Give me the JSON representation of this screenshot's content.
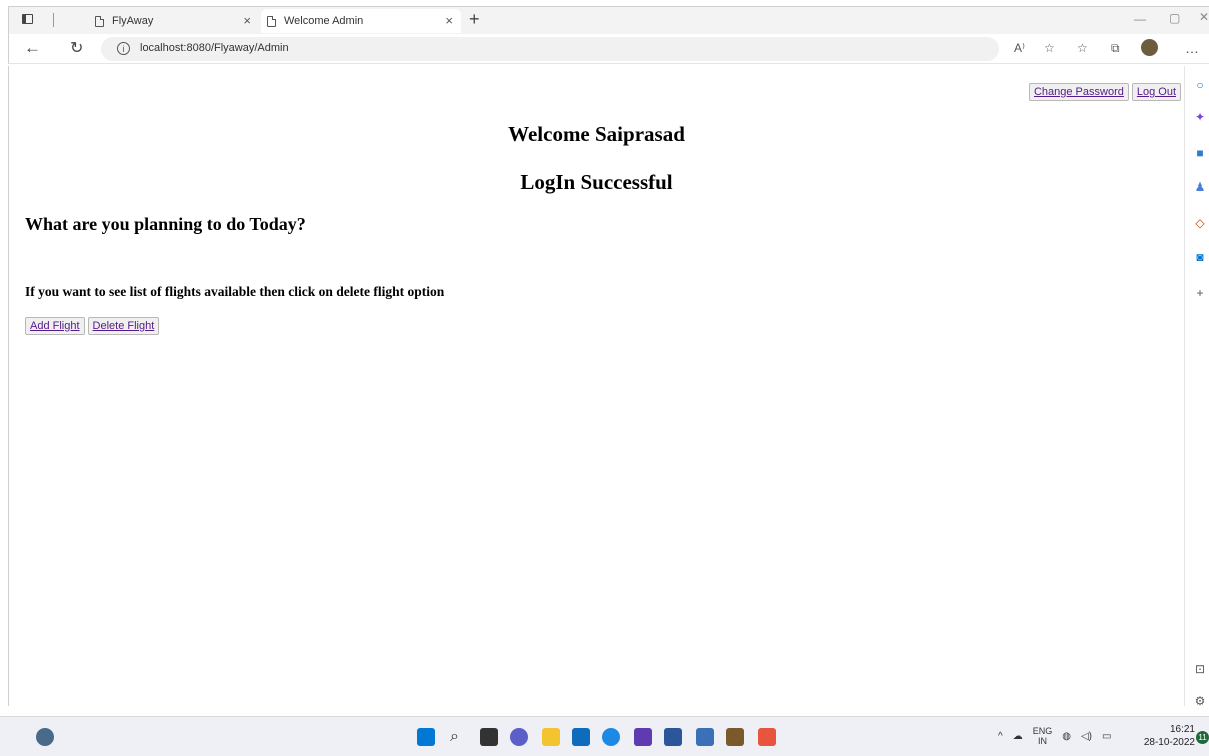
{
  "tabs": [
    {
      "title": "FlyAway",
      "close": "×"
    },
    {
      "title": "Welcome Admin",
      "close": "×"
    }
  ],
  "new_tab_symbol": "+",
  "window_controls": {
    "minimize": "—",
    "maximize": "▢",
    "close": "✕"
  },
  "address": {
    "url": "localhost:8080/Flyaway/Admin"
  },
  "toolbar_icons": [
    "read-aloud-icon",
    "favorite-add-icon",
    "favorites-icon",
    "collections-icon",
    "profile-avatar",
    "more-icon"
  ],
  "page": {
    "topnav": {
      "change_password": "Change Password",
      "logout": "Log Out"
    },
    "welcome": "Welcome Saiprasad",
    "login_status": "LogIn Successful",
    "question": "What are you planning to do Today?",
    "instruction": "If you want to see list of flights available then click on delete flight option",
    "actions": {
      "add": "Add Flight",
      "delete": "Delete Flight"
    }
  },
  "taskbar": {
    "lang": "ENG",
    "region": "IN",
    "time": "16:21",
    "date": "28-10-2022",
    "notification_count": "11"
  }
}
